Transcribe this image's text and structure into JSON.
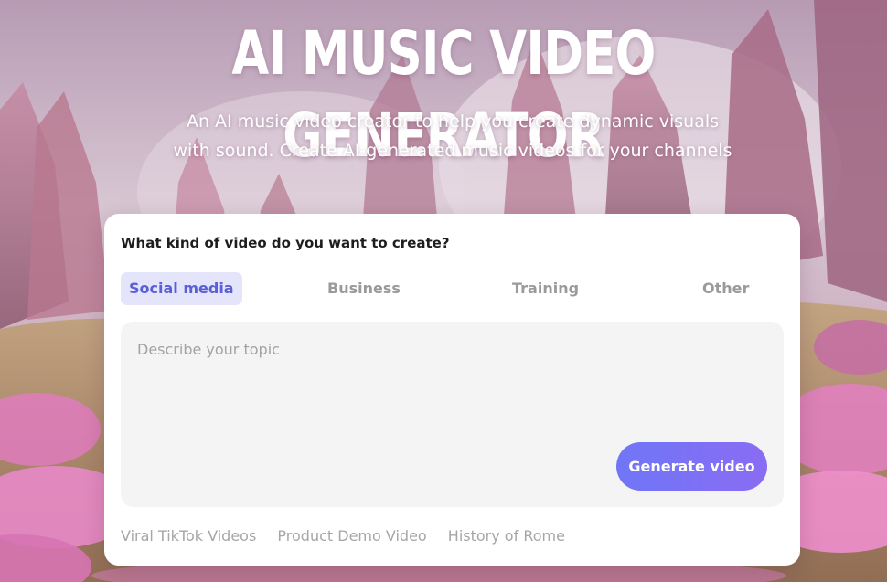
{
  "hero": {
    "title": "AI MUSIC VIDEO GENERATOR",
    "subtitle_line1": "An AI music video creator to help you create dynamic visuals",
    "subtitle_line2": "with sound. Create AI-generated music videos for your channels"
  },
  "form": {
    "prompt": "What kind of video do you want to create?",
    "tabs": [
      {
        "label": "Social media",
        "active": true
      },
      {
        "label": "Business",
        "active": false
      },
      {
        "label": "Training",
        "active": false
      },
      {
        "label": "Other",
        "active": false
      }
    ],
    "topic_placeholder": "Describe your topic",
    "generate_label": "Generate video",
    "suggestions": [
      "Viral TikTok Videos",
      "Product Demo Video",
      "History of Rome"
    ]
  },
  "colors": {
    "accent": "#5a5fd6",
    "tab_active_bg": "#e4e5fb",
    "button_gradient_start": "#6f76f6",
    "button_gradient_end": "#8a6cf4"
  }
}
